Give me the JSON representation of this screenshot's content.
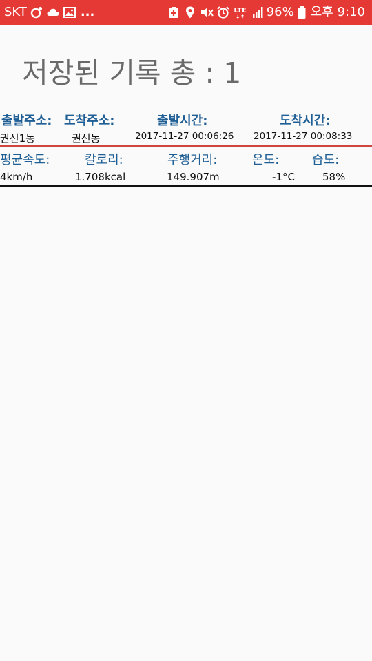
{
  "status_bar": {
    "carrier": "SKT",
    "more": "...",
    "network": "LTE",
    "battery": "96%",
    "time": "오후 9:10",
    "icons": [
      "sync-icon",
      "cloud-icon",
      "image-icon",
      "battery-saver-icon",
      "location-icon",
      "mute-icon",
      "alarm-icon",
      "lte-icon",
      "signal-icon",
      "battery-icon"
    ]
  },
  "page": {
    "title": "저장된 기록 총 : 1"
  },
  "record": {
    "headers": {
      "start_address": "출발주소:",
      "end_address": "도착주소:",
      "start_time": "출발시간:",
      "end_time": "도착시간:"
    },
    "values": {
      "start_address": "권선1동",
      "end_address": "권선동",
      "start_time": "2017-11-27 00:06:26",
      "end_time": "2017-11-27 00:08:33"
    },
    "stat_headers": {
      "avg_speed": "평균속도:",
      "calories": "칼로리:",
      "distance": "주행거리:",
      "temperature": "온도:",
      "humidity": "습도:"
    },
    "stat_values": {
      "avg_speed": "4km/h",
      "calories": "1.708kcal",
      "distance": "149.907m",
      "temperature": "-1°C",
      "humidity": "58%"
    }
  },
  "colors": {
    "status_bar": "#e53935",
    "header_text": "#1f5f95",
    "title_text": "#6a6a6a",
    "divider_red": "#d0453d"
  }
}
